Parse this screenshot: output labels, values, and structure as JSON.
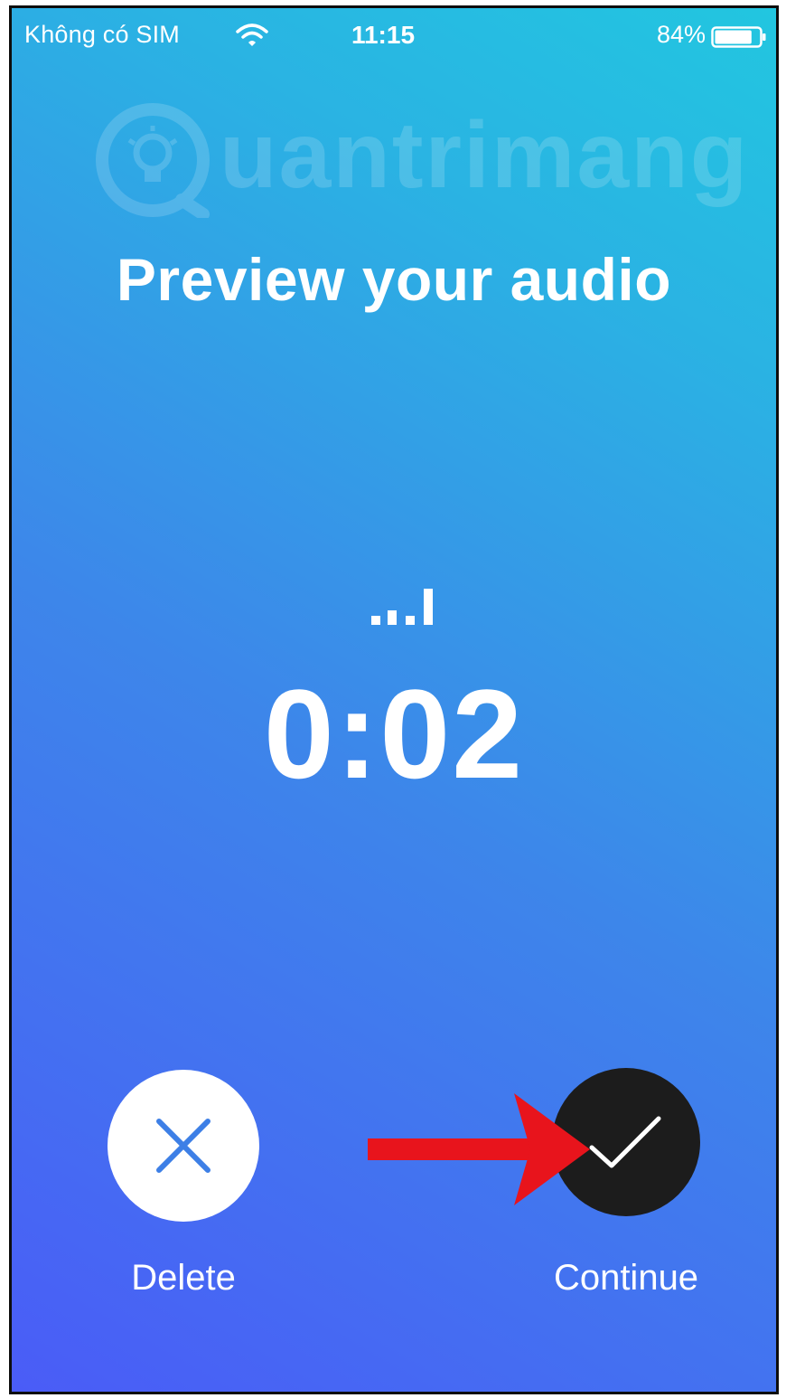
{
  "status_bar": {
    "carrier": "Không có SIM",
    "time": "11:15",
    "battery_percent": "84%",
    "battery_level": 0.84
  },
  "watermark": {
    "text": "uantrimang"
  },
  "title": "Preview your audio",
  "recording": {
    "level_icon": "audio-level-icon",
    "elapsed": "0:02"
  },
  "actions": {
    "delete_label": "Delete",
    "continue_label": "Continue"
  },
  "colors": {
    "gradient_start": "#4a5cf7",
    "gradient_end": "#22c6e0",
    "delete_icon": "#3d7fe6",
    "continue_bg": "#1c1c1c",
    "annotation_arrow": "#e8141c"
  }
}
